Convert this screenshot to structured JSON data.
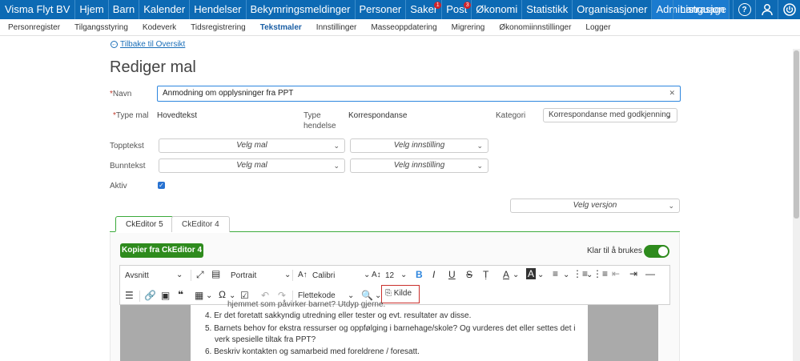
{
  "topbar": {
    "brand": "Visma Flyt BV",
    "nav": [
      {
        "label": "Hjem",
        "badge": ""
      },
      {
        "label": "Barn",
        "badge": ""
      },
      {
        "label": "Kalender",
        "badge": ""
      },
      {
        "label": "Hendelser",
        "badge": ""
      },
      {
        "label": "Bekymringsmeldinger",
        "badge": ""
      },
      {
        "label": "Personer",
        "badge": ""
      },
      {
        "label": "Saker",
        "badge": "1"
      },
      {
        "label": "Post",
        "badge": "3"
      },
      {
        "label": "Økonomi",
        "badge": ""
      },
      {
        "label": "Statistikk",
        "badge": ""
      },
      {
        "label": "Organisasjoner",
        "badge": ""
      },
      {
        "label": "Administrasjon",
        "badge": ""
      }
    ],
    "language": "Language",
    "help_glyph": "?"
  },
  "subnav": [
    "Personregister",
    "Tilgangsstyring",
    "Kodeverk",
    "Tidsregistrering",
    "Tekstmaler",
    "Innstillinger",
    "Masseoppdatering",
    "Migrering",
    "Økonomiinnstillinger",
    "Logger"
  ],
  "back_link": "Tilbake til Oversikt",
  "page_title": "Rediger mal",
  "form": {
    "name_req": "*",
    "name_label": "Navn",
    "name_value": "Anmodning  om opplysninger fra PPT",
    "type_req": "*",
    "type_label": "Type mal",
    "type_value": "Hovedtekst",
    "event_type_label_1": "Type",
    "event_type_label_2": "hendelse",
    "event_type_value": "Korrespondanse",
    "category_label": "Kategori",
    "category_value": "Korrespondanse med godkjenning",
    "header_label": "Topptekst",
    "footer_label": "Bunntekst",
    "select_template": "Velg mal",
    "select_setting": "Velg innstilling",
    "active_label": "Aktiv",
    "version_select": "Velg versjon"
  },
  "tabs": [
    "CkEditor 5",
    "CkEditor 4"
  ],
  "editor": {
    "copy_button": "Kopier fra CkEditor 4",
    "ready_label": "Klar til å brukes",
    "toolbar": {
      "paragraph": "Avsnitt",
      "page_orientation": "Portrait",
      "font_family": "Calibri",
      "font_size": "12",
      "merge_code": "Flettekode",
      "source": "Kilde"
    },
    "content_lines": [
      "hjemmet som påvirker barnet? Utdyp gjerne.",
      "4. Er det foretatt sakkyndig utredning eller tester og evt. resultater av disse.",
      "5. Barnets behov for ekstra ressurser og oppfølging i barnehage/skole? Og vurderes det eller settes det i",
      "verk spesielle tiltak fra PPT?",
      "6. Beskriv kontakten og samarbeid med foreldrene / foresatt."
    ]
  },
  "colors": {
    "brand_blue": "#0d6ab4",
    "accent_green": "#2e8b1d",
    "highlight_red": "#c9302c"
  }
}
